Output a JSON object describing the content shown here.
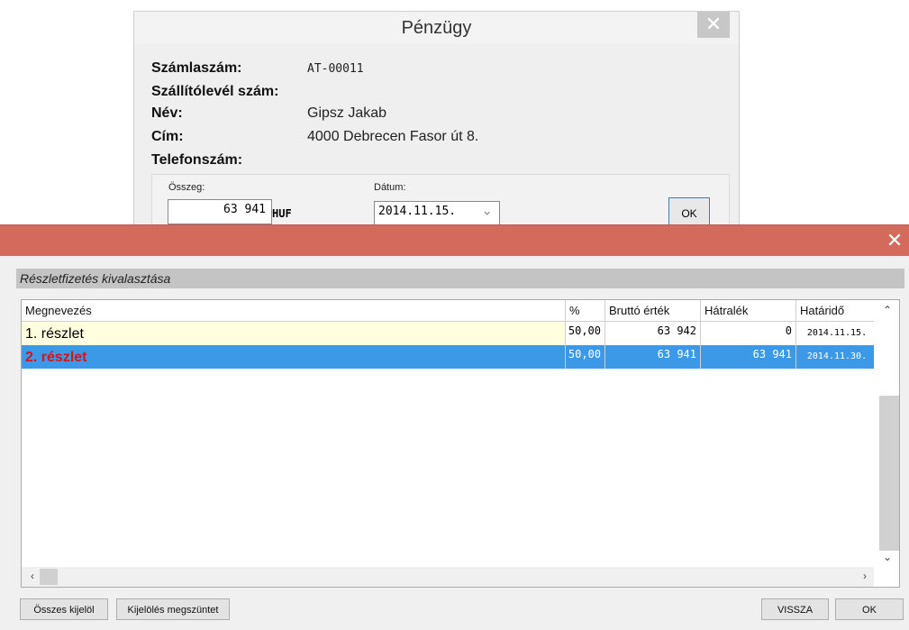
{
  "finance_dialog": {
    "title": "Pénzügy",
    "close": "✕",
    "fields": [
      {
        "label": "Számlaszám:",
        "value": "AT-00011"
      },
      {
        "label": "Szállítólevél szám:",
        "value": ""
      },
      {
        "label": "Név:",
        "value": "Gipsz Jakab"
      },
      {
        "label": "Cím:",
        "value": "4000 Debrecen Fasor út 8."
      },
      {
        "label": "Telefonszám:",
        "value": ""
      }
    ],
    "amount_label": "Összeg:",
    "amount_value": "63 941",
    "currency": "HUF",
    "date_label": "Dátum:",
    "date_value": "2014.11.15.",
    "ok_label": "OK"
  },
  "installment_dialog": {
    "close": "✕",
    "section_title": "Részletfizetés kivalasztása",
    "columns": [
      "Megnevezés",
      "%",
      "Bruttó érték",
      "Hátralék",
      "Határidő"
    ],
    "rows": [
      {
        "name": "1. részlet",
        "percent": "50,00",
        "gross": "63 942",
        "remaining": "0",
        "deadline": "2014.11.15."
      },
      {
        "name": "2. részlet",
        "percent": "50,00",
        "gross": "63 941",
        "remaining": "63 941",
        "deadline": "2014.11.30."
      }
    ],
    "buttons": {
      "select_all": "Összes kijelöl",
      "deselect": "Kijelölés megszüntet",
      "back": "VISSZA",
      "ok": "OK"
    }
  },
  "colors": {
    "titlebar_accent": "#d46a5c",
    "selected_row": "#3b99e8",
    "first_row_highlight": "#ffffe0",
    "selected_name_text": "#e01010"
  }
}
